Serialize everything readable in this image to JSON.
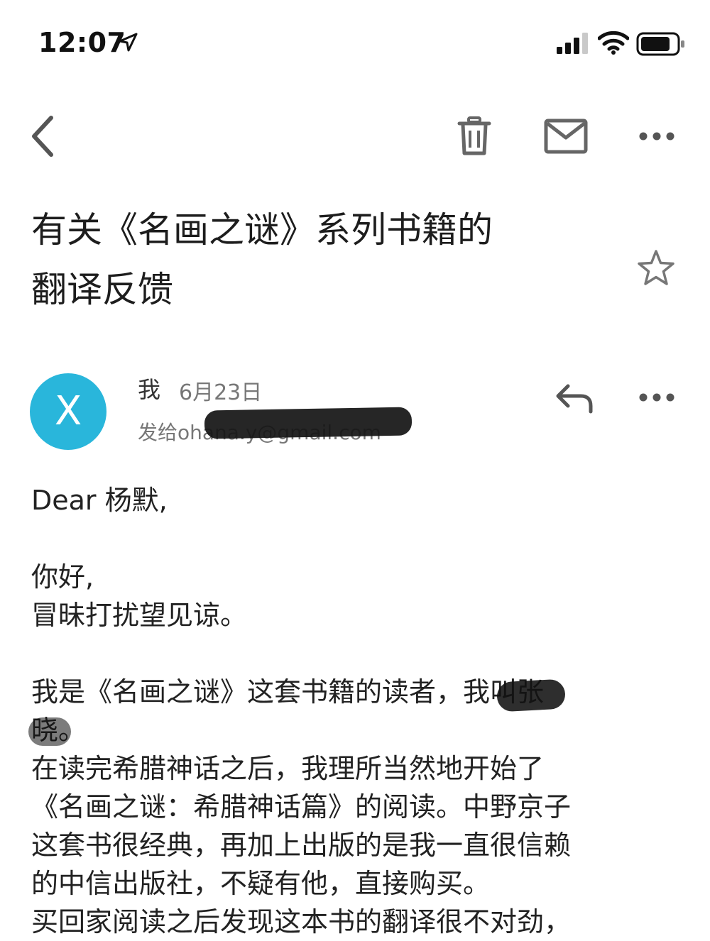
{
  "status_bar": {
    "time": "12:07",
    "icons": [
      "location-arrow-icon",
      "cellular-signal-icon",
      "wifi-icon",
      "battery-icon"
    ]
  },
  "toolbar": {
    "icons": [
      "back-chevron-icon",
      "trash-icon",
      "mail-icon",
      "more-horizontal-icon"
    ]
  },
  "email": {
    "subject_lines": [
      "有关《名画之谜》系列书籍的",
      "翻译反馈"
    ],
    "starred": false,
    "sender": {
      "avatar_letter": "X",
      "avatar_color": "#29b6db",
      "name": "我",
      "date": "6月23日",
      "recipient_line": "发给ohana.y@gmail.com"
    },
    "body": {
      "greeting": "Dear 杨默,",
      "para1": [
        "你好,",
        "冒昧打扰望见谅。"
      ],
      "para2": {
        "line1_visible": "我是《名画之谜》这套书籍的读者，我",
        "line1_redacted": "叫张",
        "line2_redacted": "晓",
        "line2_end": "。",
        "lines": [
          "在读完希腊神话之后，我理所当然地开始了",
          "《名画之谜：希腊神话篇》的阅读。中野京子",
          "这套书很经典，再加上出版的是我一直很信赖",
          "的中信出版社，不疑有他，直接购买。",
          "买回家阅读之后发现这本书的翻译很不对劲，"
        ]
      }
    }
  },
  "colors": {
    "icon_gray": "#6b6b6b",
    "redaction": "#151515"
  }
}
